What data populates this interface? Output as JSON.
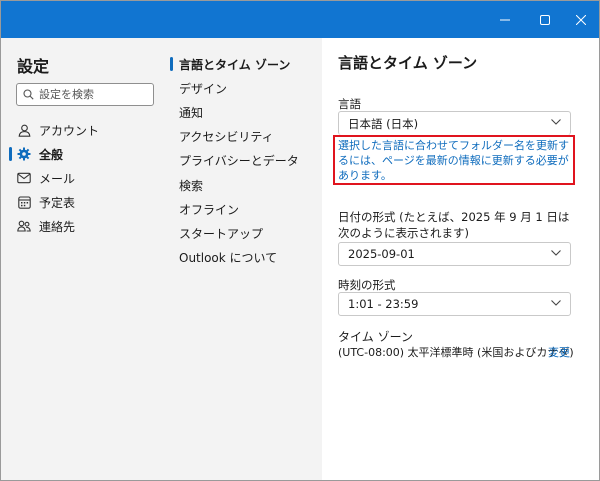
{
  "window": {
    "controls": [
      "minimize-icon",
      "maximize-icon",
      "close-icon"
    ],
    "accent_color": "#1175d1"
  },
  "nav": {
    "title": "設定",
    "search_placeholder": "設定を検索",
    "items": [
      {
        "label": "アカウント",
        "icon": "person-icon"
      },
      {
        "label": "全般",
        "icon": "gear-icon",
        "active": true
      },
      {
        "label": "メール",
        "icon": "mail-icon"
      },
      {
        "label": "予定表",
        "icon": "calendar-icon"
      },
      {
        "label": "連絡先",
        "icon": "people-icon"
      }
    ]
  },
  "subnav": {
    "items": [
      {
        "label": "言語とタイム ゾーン",
        "active": true
      },
      {
        "label": "デザイン"
      },
      {
        "label": "通知"
      },
      {
        "label": "アクセシビリティ"
      },
      {
        "label": "プライバシーとデータ"
      },
      {
        "label": "検索"
      },
      {
        "label": "オフライン"
      },
      {
        "label": "スタートアップ"
      },
      {
        "label": "Outlook について"
      }
    ]
  },
  "content": {
    "title": "言語とタイム ゾーン",
    "language_label": "言語",
    "language_value": "日本語 (日本)",
    "notice": "選択した言語に合わせてフォルダー名を更新するには、ページを最新の情報に更新する必要があります。",
    "date_format_label": "日付の形式 (たとえば、2025 年 9 月 1 日は次のように表示されます)",
    "date_format_value": "2025-09-01",
    "time_format_label": "時刻の形式",
    "time_format_value": "1:01 - 23:59",
    "timezone_label": "タイム ゾーン",
    "timezone_value": "(UTC-08:00) 太平洋標準時 (米国およびカナダ)",
    "timezone_change": "変更"
  }
}
